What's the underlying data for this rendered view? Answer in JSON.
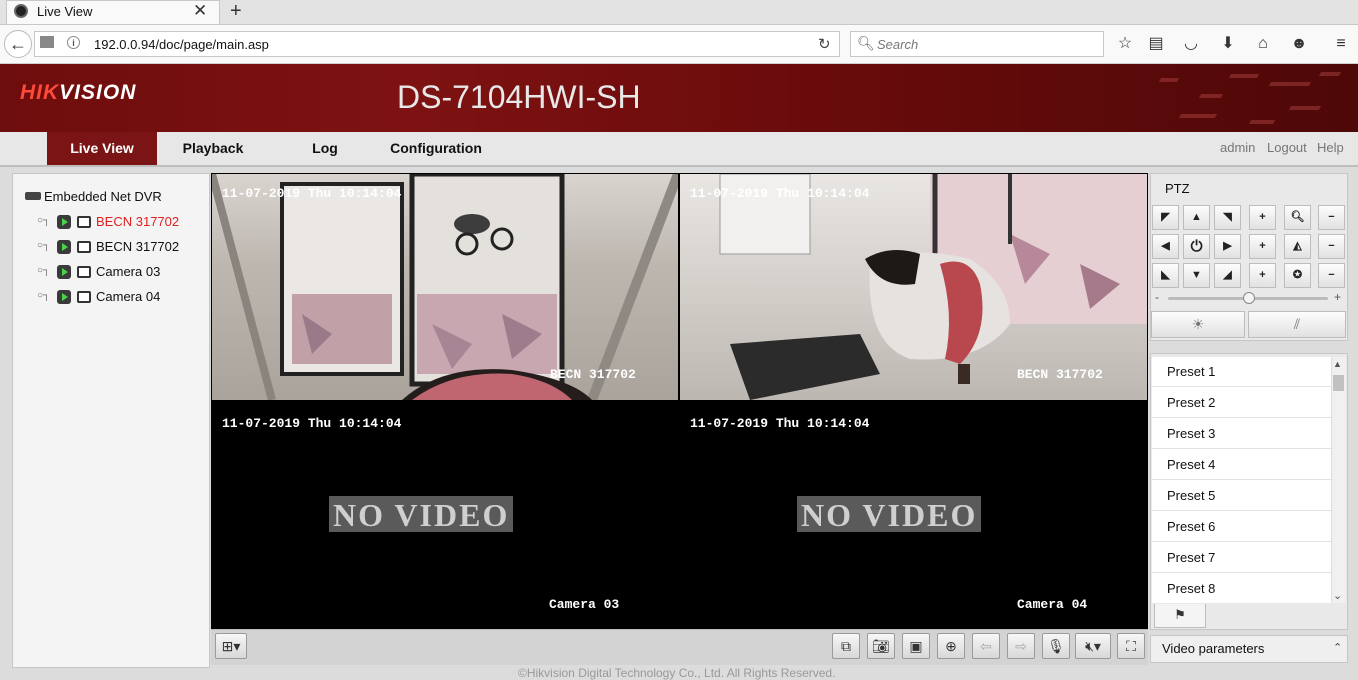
{
  "browser": {
    "tab_title": "Live View",
    "new_tab": "+",
    "url": "192.0.0.94/doc/page/main.asp",
    "search_placeholder": "Search"
  },
  "header": {
    "logo": "HIKVISION",
    "model": "DS-7104HWI-SH"
  },
  "menu": {
    "items": [
      "Live View",
      "Playback",
      "Log",
      "Configuration"
    ],
    "active": "Live View",
    "user_links": [
      "admin",
      "Logout",
      "Help"
    ]
  },
  "tree": {
    "root": "Embedded Net DVR",
    "cameras": [
      {
        "label": "BECN 317702",
        "selected": true
      },
      {
        "label": "BECN 317702",
        "selected": false
      },
      {
        "label": "Camera 03",
        "selected": false
      },
      {
        "label": "Camera 04",
        "selected": false
      }
    ]
  },
  "video": {
    "tiles": [
      {
        "timestamp": "11-07-2019 Thu 10:14:04",
        "name": "BECN 317702",
        "no_video": false
      },
      {
        "timestamp": "11-07-2019 Thu 10:14:04",
        "name": "BECN 317702",
        "no_video": false
      },
      {
        "timestamp": "11-07-2019 Thu 10:14:04",
        "name": "Camera 03",
        "no_video": true
      },
      {
        "timestamp": "11-07-2019 Thu 10:14:04",
        "name": "Camera 04",
        "no_video": true
      }
    ],
    "no_video_text": "NO VIDEO"
  },
  "ptz": {
    "title": "PTZ",
    "min_label": "-",
    "max_label": "+"
  },
  "presets": {
    "items": [
      "Preset 1",
      "Preset 2",
      "Preset 3",
      "Preset 4",
      "Preset 5",
      "Preset 6",
      "Preset 7",
      "Preset 8"
    ]
  },
  "video_parameters": {
    "label": "Video parameters"
  },
  "footer": {
    "copyright": "©Hikvision Digital Technology Co., Ltd. All Rights Reserved."
  },
  "colors": {
    "brand_red": "#7b1515",
    "selected_camera": "#e02020"
  }
}
